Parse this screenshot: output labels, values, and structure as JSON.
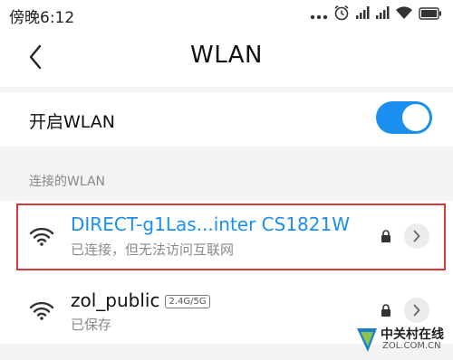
{
  "status_bar": {
    "time": "傍晚6:12",
    "icons": [
      "more-dots-icon",
      "alarm-icon",
      "signal-icon",
      "signal-icon",
      "wifi-icon",
      "battery-icon"
    ]
  },
  "header": {
    "back_icon": "chevron-left-icon",
    "title": "WLAN"
  },
  "wlan_toggle": {
    "label": "开启WLAN",
    "enabled": true,
    "color": "#1a8ff0"
  },
  "section": {
    "label": "连接的WLAN"
  },
  "networks": [
    {
      "name": "DIRECT-g1Las...inter CS1821W",
      "status": "已连接，但无法访问互联网",
      "name_color": "#1a8ff0",
      "secured": true,
      "highlighted": true
    },
    {
      "name": "zol_public",
      "band": "2.4G/5G",
      "status": "已保存",
      "name_color": "#111111",
      "secured": true,
      "highlighted": false
    }
  ],
  "watermark": {
    "text": "中关村在线",
    "sub": "ZOL.COM.CN"
  }
}
